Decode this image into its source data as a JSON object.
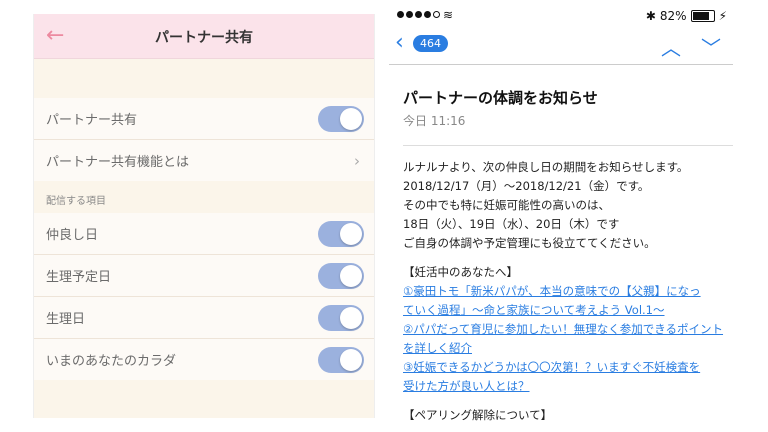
{
  "left": {
    "title": "パートナー共有",
    "rows_top": [
      {
        "label": "パートナー共有",
        "toggle_on": true
      },
      {
        "label": "パートナー共有機能とは",
        "chevron": true
      }
    ],
    "section_header": "配信する項目",
    "rows_items": [
      {
        "label": "仲良し日",
        "toggle_on": true
      },
      {
        "label": "生理予定日",
        "toggle_on": true
      },
      {
        "label": "生理日",
        "toggle_on": true
      },
      {
        "label": "いまのあなたのカラダ",
        "toggle_on": true
      }
    ],
    "colors": {
      "nav_bg": "#fbe3ea",
      "back_arrow": "#ec8aa0",
      "toggle_on": "#9bb1de"
    }
  },
  "right": {
    "status": {
      "battery": "82%"
    },
    "badge": "464",
    "subject": "パートナーの体調をお知らせ",
    "time": "今日 11:16",
    "lines": [
      "ルナルナより、次の仲良し日の期間をお知らせします。",
      "2018/12/17（月）〜2018/12/21（金）です。",
      "その中でも特に妊娠可能性の高いのは、",
      "18日（火）、19日（水）、20日（木）です",
      "ご自身の体調や予定管理にも役立ててください。"
    ],
    "section1": "【妊活中のあなたへ】",
    "links": [
      "①豪田トモ「新米パパが、本当の意味での【父親】になっ",
      "ていく過程」〜命と家族について考えよう Vol.1〜",
      "②パパだって育児に参加したい！無理なく参加できるポイント",
      "を詳しく紹介",
      "③妊娠できるかどうかは〇〇次第！？いますぐ不妊検査を",
      "受けた方が良い人とは？"
    ],
    "section2": "【ペアリング解除について】",
    "colors": {
      "link": "#2a7de1"
    }
  }
}
